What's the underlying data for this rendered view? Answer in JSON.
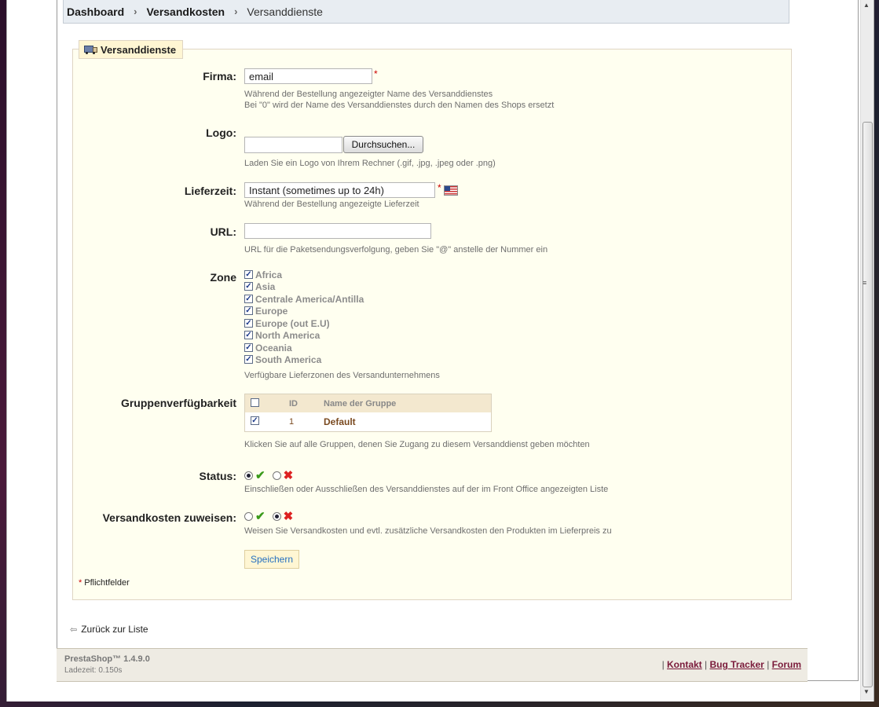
{
  "breadcrumb": [
    "Dashboard",
    "Versandkosten",
    "Versanddienste"
  ],
  "section_title": "Versanddienste",
  "fields": {
    "firma": {
      "label": "Firma:",
      "value": "email",
      "hint1": "Während der Bestellung angezeigter Name des Versanddienstes",
      "hint2": "Bei \"0\" wird der Name des Versanddienstes durch den Namen des Shops ersetzt"
    },
    "logo": {
      "label": "Logo:",
      "browse_label": "Durchsuchen...",
      "hint": "Laden Sie ein Logo von Ihrem Rechner (.gif, .jpg, .jpeg oder .png)"
    },
    "lieferzeit": {
      "label": "Lieferzeit:",
      "value": "Instant (sometimes up to 24h)",
      "hint": "Während der Bestellung angezeigte Lieferzeit"
    },
    "url": {
      "label": "URL:",
      "value": "",
      "hint": "URL für die Paketsendungsverfolgung, geben Sie \"@\" anstelle der Nummer ein"
    },
    "zone": {
      "label": "Zone",
      "items": [
        "Africa",
        "Asia",
        "Centrale America/Antilla",
        "Europe",
        "Europe (out E.U)",
        "North America",
        "Oceania",
        "South America"
      ],
      "hint": "Verfügbare Lieferzonen des Versandunternehmens"
    },
    "groups": {
      "label": "Gruppenverfügbarkeit",
      "col_id": "ID",
      "col_name": "Name der Gruppe",
      "rows": [
        {
          "id": "1",
          "name": "Default"
        }
      ],
      "hint": "Klicken Sie auf alle Gruppen, denen Sie Zugang zu diesem Versanddienst geben möchten"
    },
    "status": {
      "label": "Status:",
      "hint": "Einschließen oder Ausschließen des Versanddienstes auf der im Front Office angezeigten Liste"
    },
    "versandkosten": {
      "label": "Versandkosten zuweisen:",
      "hint": "Weisen Sie Versandkosten und evtl. zusätzliche Versandkosten den Produkten im Lieferpreis zu"
    }
  },
  "required_star": "*",
  "save_label": "Speichern",
  "required_note": "Pflichtfelder",
  "back_link": "Zurück zur Liste",
  "footer": {
    "version": "PrestaShop™ 1.4.9.0",
    "load_time": "Ladezeit: 0.150s",
    "links": [
      "Kontakt",
      "Bug Tracker",
      "Forum"
    ]
  },
  "colors": {
    "fieldset_bg": "#fffff0",
    "legend_bg": "#fff6d3",
    "required": "#cc0000",
    "link_blue": "#2570c0",
    "footer_link": "#7a1a3a"
  }
}
